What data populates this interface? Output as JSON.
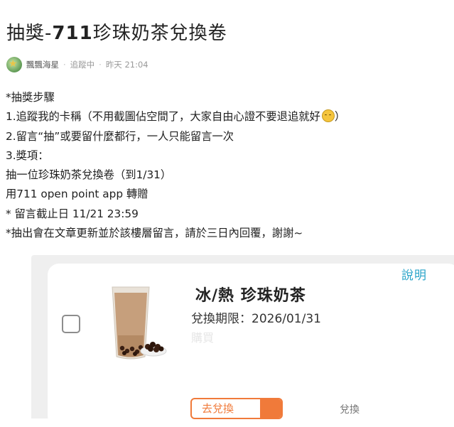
{
  "post": {
    "title_prefix": "抽獎-",
    "title_bold": "711",
    "title_suffix": "珍珠奶茶兌換卷",
    "author": "飄飄海星",
    "follow_status": "追蹤中",
    "timestamp": "昨天 21:04",
    "lines": {
      "l1": "*抽獎步驟",
      "l2": "1.追蹤我的卡稱（不用截圖佔空間了，大家自由心證不要退追就好",
      "l2_end": "）",
      "l3": "2.留言“抽”或要留什麼都行，一人只能留言一次",
      "l4": "3.獎項：",
      "l5": "抽一位珍珠奶茶兌換卷（到1/31）",
      "l6": "用711 open point app 轉贈",
      "l7": "* 留言截止日 11/21 23:59",
      "l8": "*抽出會在文章更新並於該樓層留言，請於三日內回覆，謝謝~"
    }
  },
  "coupon": {
    "explain_label": "說明",
    "product_name": "冰/熱 珍珠奶茶",
    "expiry": "兌換期限：2026/01/31",
    "buy_text": "購買",
    "button_label": "去兌換",
    "bottom_right_text": "兌換",
    "accent": "#f07a3a",
    "link_color": "#2aa4c9"
  }
}
